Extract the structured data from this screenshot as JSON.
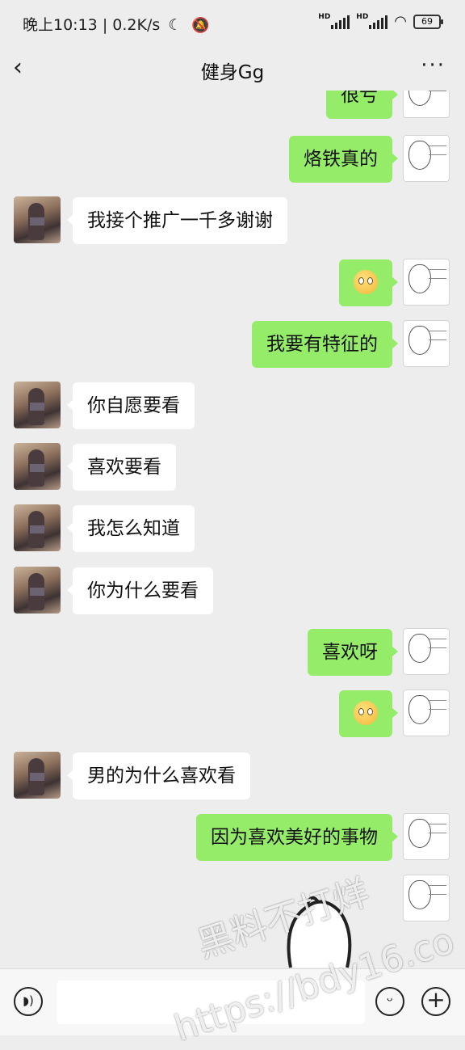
{
  "status_bar": {
    "time": "晚上10:13",
    "separator": "|",
    "net_speed": "0.2K/s",
    "battery": "69",
    "hd1": "HD",
    "hd2": "HD"
  },
  "header": {
    "title": "健身Gg",
    "back_glyph": "‹",
    "more_glyph": "···"
  },
  "messages": [
    {
      "side": "out",
      "text": "很亏"
    },
    {
      "side": "out",
      "text": "烙铁真的"
    },
    {
      "side": "in",
      "text": "我接个推广一千多谢谢"
    },
    {
      "side": "out",
      "text": "",
      "emoji": "pleading-face-emoji"
    },
    {
      "side": "out",
      "text": "我要有特征的"
    },
    {
      "side": "in",
      "text": "你自愿要看"
    },
    {
      "side": "in",
      "text": "喜欢要看"
    },
    {
      "side": "in",
      "text": "我怎么知道"
    },
    {
      "side": "in",
      "text": "你为什么要看"
    },
    {
      "side": "out",
      "text": "喜欢呀"
    },
    {
      "side": "out",
      "text": "",
      "emoji": "pleading-face-emoji"
    },
    {
      "side": "in",
      "text": "男的为什么喜欢看"
    },
    {
      "side": "out",
      "text": "因为喜欢美好的事物"
    },
    {
      "side": "out",
      "text": "",
      "sticker": "meme-sticker"
    }
  ],
  "input_bar": {
    "voice_icon": "voice-icon",
    "emoji_icon": "emoji-icon",
    "plus_icon": "plus-icon",
    "text": ""
  },
  "watermark": {
    "line1": "黑料不打烊",
    "line2": "https://bdy16.co"
  },
  "colors": {
    "background": "#ededed",
    "outgoing_bubble": "#95ec69",
    "incoming_bubble": "#ffffff"
  }
}
